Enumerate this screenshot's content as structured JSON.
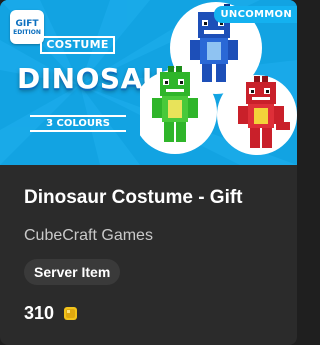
{
  "banner": {
    "gift_badge_top": "GIFT",
    "gift_badge_bottom": "EDITION",
    "costume_label": "COSTUME",
    "title": "DINOSAUR",
    "colours_label": "3 COLOURS",
    "rarity": "UNCOMMON"
  },
  "item": {
    "title": "Dinosaur Costume - Gift",
    "creator": "CubeCraft Games",
    "tag": "Server Item",
    "price": "310",
    "currency_icon": "minecoin-icon"
  },
  "colors": {
    "banner_bg": "#12a3e2",
    "card_bg": "#2b2b2b",
    "tag_bg": "#3a3a3a",
    "coin": "#f2c31b"
  }
}
